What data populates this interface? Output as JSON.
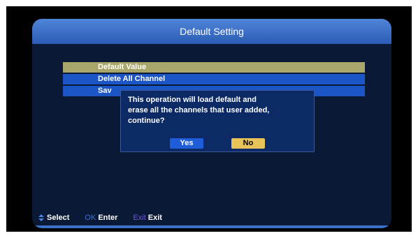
{
  "title": "Default Setting",
  "menu": {
    "items": [
      {
        "label": "Default Value",
        "selected": true
      },
      {
        "label": "Delete All Channel",
        "selected": false
      },
      {
        "label": "Sav",
        "selected": false
      }
    ]
  },
  "dialog": {
    "message": "This operation will load default and\nerase all the channels that user added,\ncontinue?",
    "yes_label": "Yes",
    "no_label": "No",
    "focused_button": "No"
  },
  "footer": {
    "select_label": "Select",
    "ok_key": "OK",
    "enter_label": "Enter",
    "exit_key": "Exit",
    "exit_label": "Exit"
  },
  "colors": {
    "title_bar": "#3d70cc",
    "menu_item": "#1c56c6",
    "menu_selected": "#a8a66a",
    "dialog_bg": "#0c2a66",
    "yes_button": "#1f5dd8",
    "no_button": "#e8c35a"
  }
}
